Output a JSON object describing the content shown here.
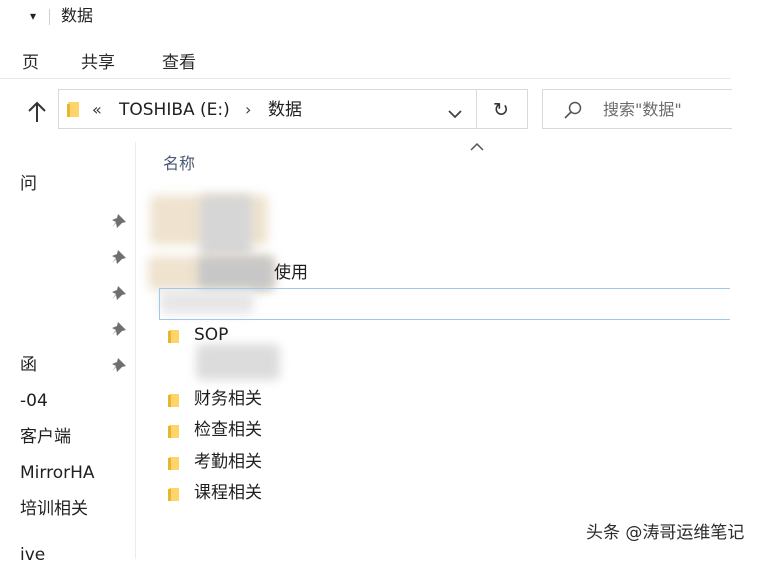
{
  "window": {
    "title": "数据",
    "quick_access_glyph": "▾"
  },
  "ribbon": {
    "tabs": [
      "页",
      "共享",
      "查看"
    ]
  },
  "address": {
    "overflow": "«",
    "drive": "TOSHIBA (E:)",
    "separator": "›",
    "folder": "数据",
    "dropdown_glyph": "⌄",
    "refresh_glyph": "↻"
  },
  "search": {
    "placeholder": "搜索\"数据\""
  },
  "nav": {
    "items": [
      "问",
      "函",
      "-04",
      "客户端",
      "MirrorHA",
      "培训相关",
      "ive"
    ]
  },
  "list": {
    "column_name": "名称",
    "partial_label": "使用",
    "items": [
      "SOP",
      "财务相关",
      "检查相关",
      "考勤相关",
      "课程相关"
    ]
  },
  "colors": {
    "folder": "#ffd56a",
    "folder_dark": "#e8b434",
    "selection": "#9fc8ea",
    "pin": "#6f6f6f"
  },
  "watermark": "头条 @涛哥运维笔记"
}
